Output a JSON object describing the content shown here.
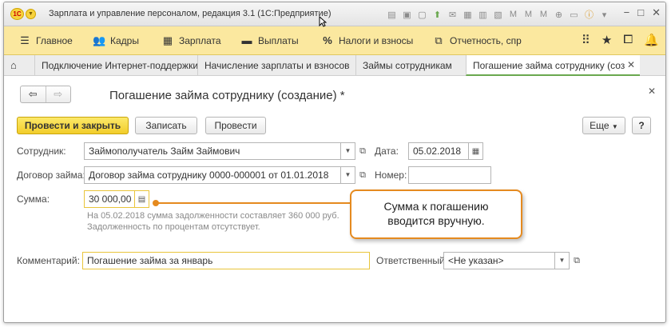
{
  "window": {
    "title": "Зарплата и управление персоналом, редакция 3.1  (1С:Предприятие)",
    "logo_text": "1С"
  },
  "menu": {
    "items": [
      {
        "label": "Главное",
        "icon": "hamburger-icon"
      },
      {
        "label": "Кадры",
        "icon": "people-icon"
      },
      {
        "label": "Зарплата",
        "icon": "calculator-icon"
      },
      {
        "label": "Выплаты",
        "icon": "wallet-icon"
      },
      {
        "label": "Налоги и взносы",
        "icon": "percent-icon"
      },
      {
        "label": "Отчетность, спр",
        "icon": "reports-icon"
      }
    ]
  },
  "tabs": [
    {
      "label": "Подключение Интернет-поддержки"
    },
    {
      "label": "Начисление зарплаты и взносов"
    },
    {
      "label": "Займы сотрудникам"
    },
    {
      "label": "Погашение займа сотруднику (соз"
    }
  ],
  "form": {
    "title": "Погашение займа сотруднику (создание) *",
    "buttons": {
      "post_close": "Провести и закрыть",
      "save": "Записать",
      "post": "Провести",
      "more": "Еще",
      "help": "?"
    },
    "employee": {
      "label": "Сотрудник:",
      "value": "Займополучатель Займ Займович"
    },
    "date": {
      "label": "Дата:",
      "value": "05.02.2018"
    },
    "contract": {
      "label": "Договор займа:",
      "value": "Договор займа сотруднику 0000-000001 от 01.01.2018"
    },
    "number": {
      "label": "Номер:",
      "value": ""
    },
    "sum": {
      "label": "Сумма:",
      "value": "30 000,00"
    },
    "note1": "На 05.02.2018 сумма задолженности составляет 360 000 руб.",
    "note2": "Задолженность по процентам отсутствует.",
    "comment": {
      "label": "Комментарий:",
      "value": "Погашение займа за январь"
    },
    "responsible": {
      "label": "Ответственный:",
      "value": "<Не указан>"
    }
  },
  "callout": {
    "line1": "Сумма к погашению",
    "line2": "вводится вручную."
  },
  "colors": {
    "menu_bg": "#fbe89f",
    "primary_button": "#f2cd2a",
    "callout_border": "#e58a1f",
    "active_tab_underline": "#6aa84f"
  }
}
